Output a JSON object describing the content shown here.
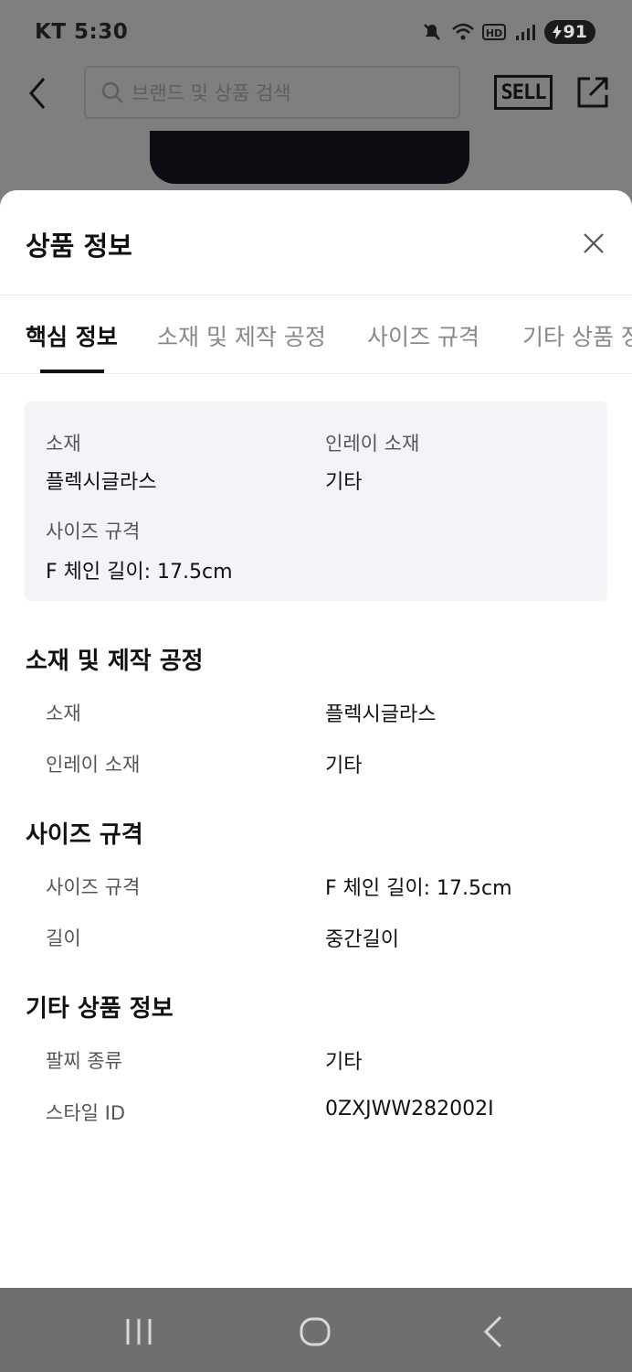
{
  "status_bar": {
    "carrier_time": "KT 5:30",
    "battery": "91"
  },
  "header": {
    "search_placeholder": "브랜드 및 상품 검색",
    "sell_label": "SELL"
  },
  "sheet": {
    "title": "상품 정보",
    "tabs": [
      "핵심 정보",
      "소재 및 제작 공정",
      "사이즈 규격",
      "기타 상품 정보"
    ],
    "summary": {
      "items": [
        {
          "label": "소재",
          "value": "플렉시글라스"
        },
        {
          "label": "인레이 소재",
          "value": "기타"
        },
        {
          "label": "사이즈 규격",
          "value": "F 체인 길이: 17.5cm"
        }
      ]
    },
    "sections": [
      {
        "title": "소재 및 제작 공정",
        "rows": [
          {
            "label": "소재",
            "value": "플렉시글라스"
          },
          {
            "label": "인레이 소재",
            "value": "기타"
          }
        ]
      },
      {
        "title": "사이즈 규격",
        "rows": [
          {
            "label": "사이즈 규격",
            "value": "F 체인 길이: 17.5cm"
          },
          {
            "label": "길이",
            "value": "중간길이"
          }
        ]
      },
      {
        "title": "기타 상품 정보",
        "rows": [
          {
            "label": "팔찌 종류",
            "value": "기타"
          },
          {
            "label": "스타일 ID",
            "value": "0ZXJWW282002I"
          }
        ]
      }
    ]
  },
  "icons": {
    "back": "chevron-left-icon",
    "search": "search-icon",
    "share": "share-icon",
    "close": "close-icon",
    "nav_recent": "recent-apps-icon",
    "nav_home": "home-icon",
    "nav_back": "nav-back-icon"
  }
}
